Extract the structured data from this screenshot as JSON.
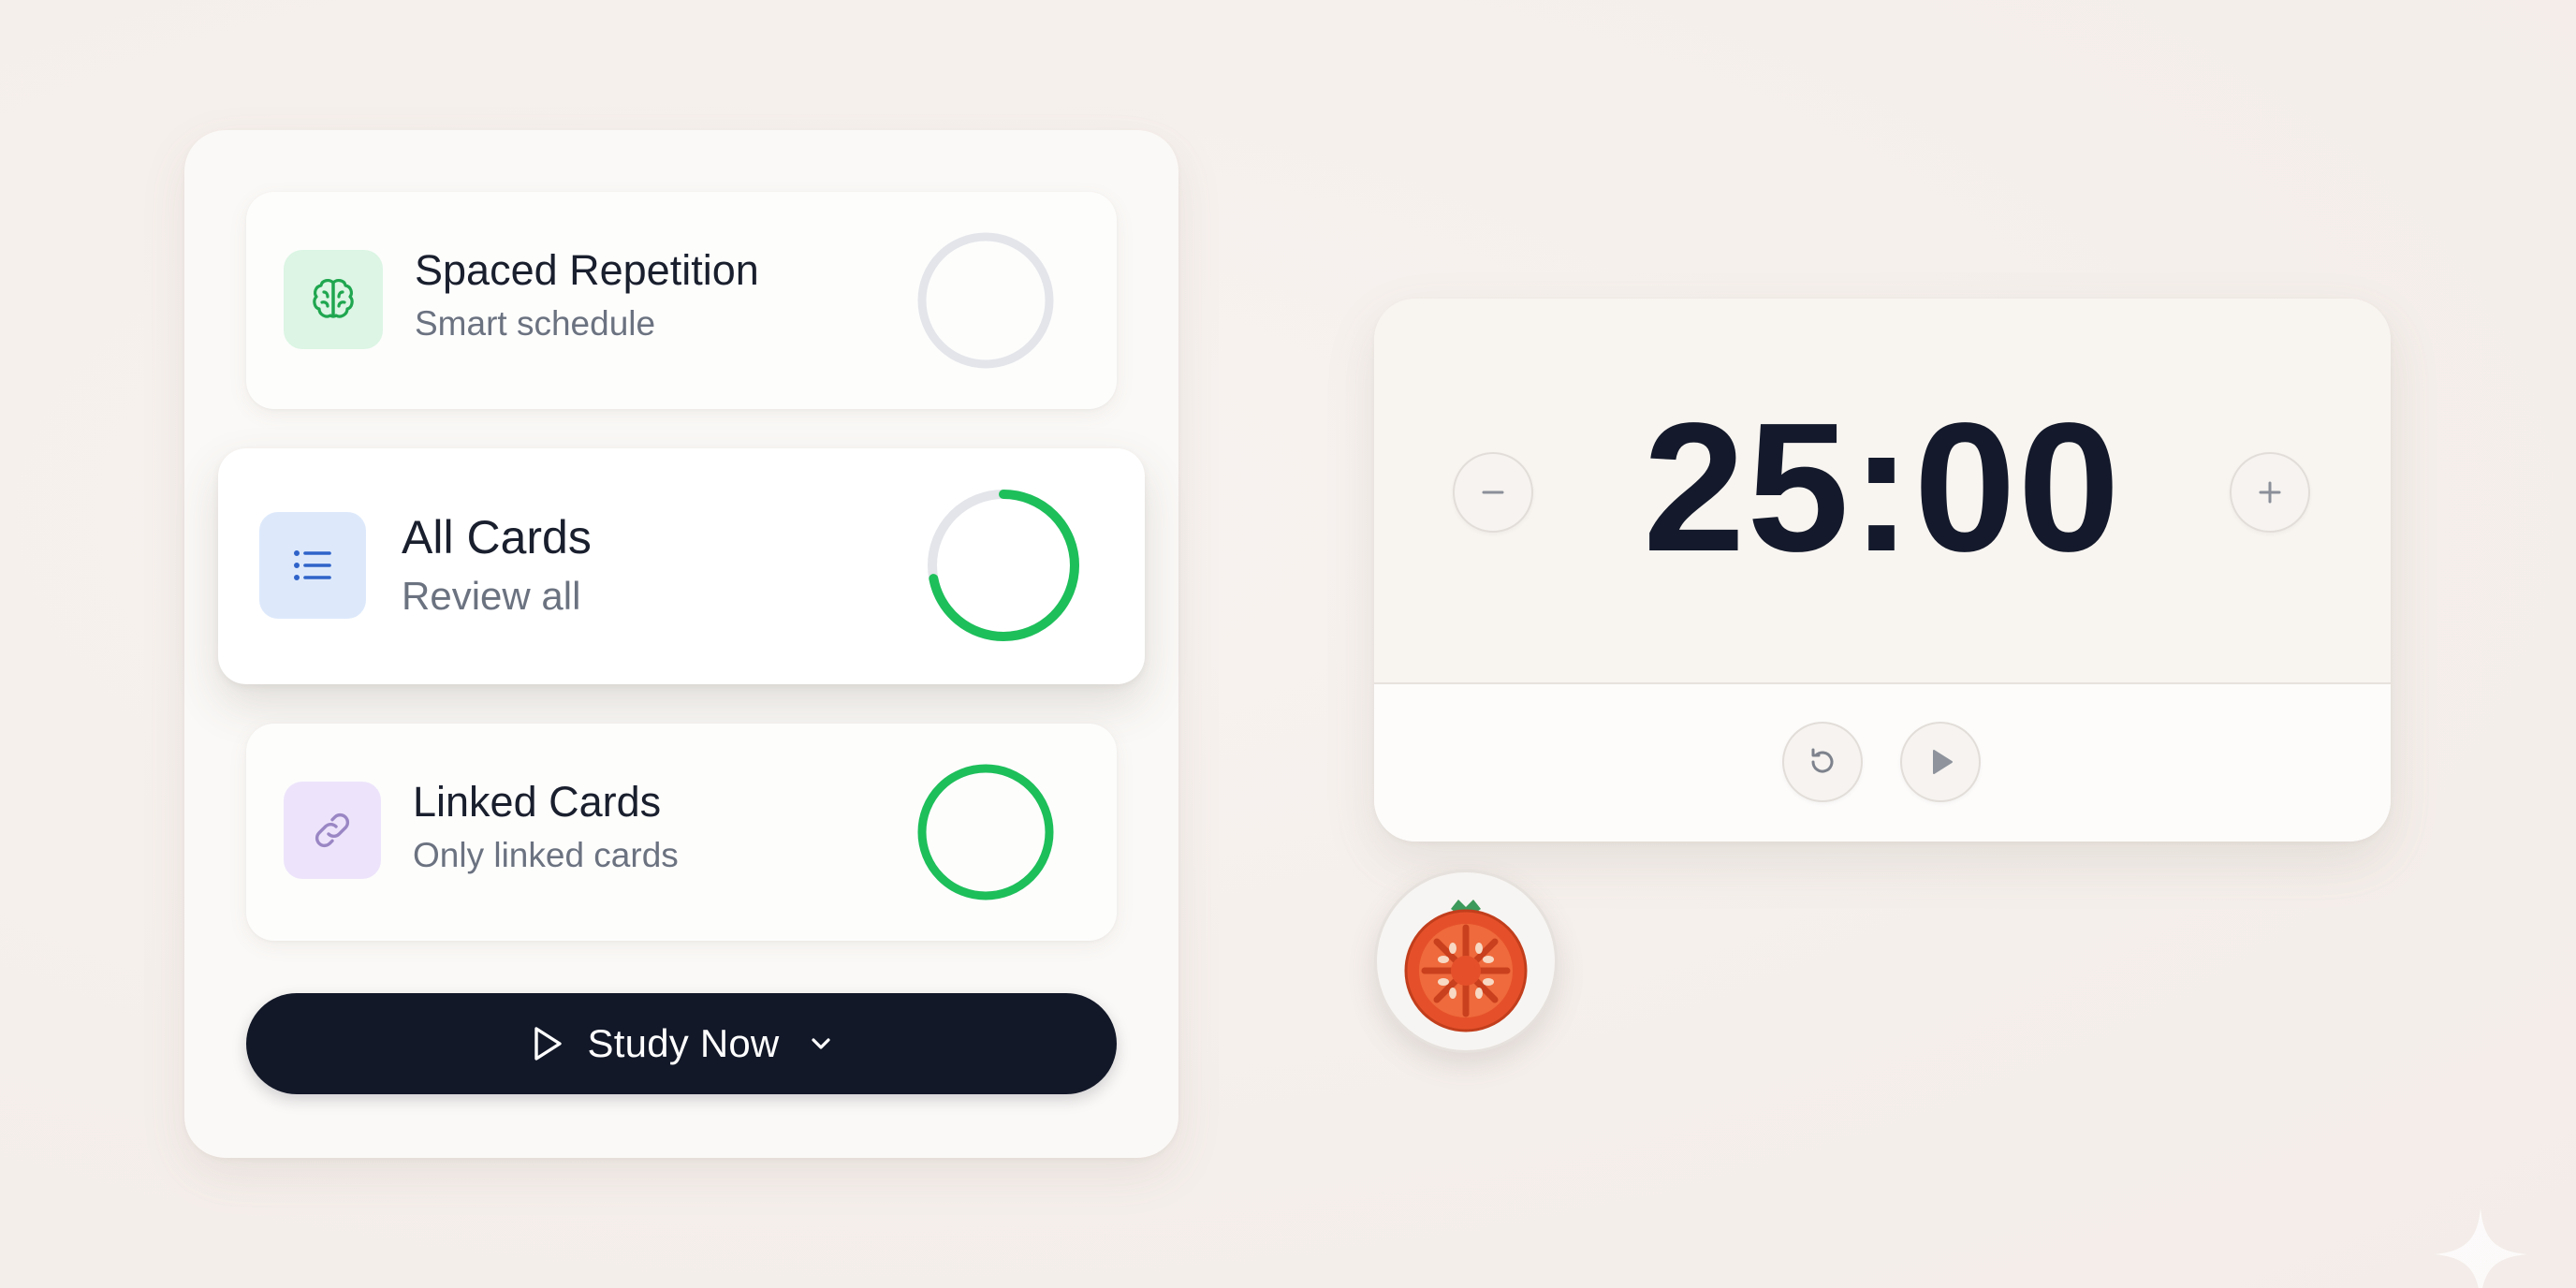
{
  "study_panel": {
    "modes": [
      {
        "title": "Spaced Repetition",
        "subtitle": "Smart schedule",
        "icon": "brain-icon",
        "icon_bg": "#dcf5e4",
        "icon_color": "#1fa64f",
        "progress": 0.0,
        "selected": false
      },
      {
        "title": "All Cards",
        "subtitle": "Review all",
        "icon": "list-icon",
        "icon_bg": "#dde9fb",
        "icon_color": "#2f63c9",
        "progress": 0.72,
        "selected": true
      },
      {
        "title": "Linked Cards",
        "subtitle": "Only linked cards",
        "icon": "link-icon",
        "icon_bg": "#ede4fb",
        "icon_color": "#9a86c4",
        "progress": 1.0,
        "selected": false
      }
    ],
    "study_button": {
      "label": "Study Now",
      "icon": "play-outline-icon",
      "dropdown_icon": "chevron-down-icon"
    }
  },
  "timer": {
    "time": "25:00",
    "decrease_icon": "minus-icon",
    "increase_icon": "plus-icon",
    "reset_icon": "reset-icon",
    "play_icon": "play-icon"
  },
  "tomato": {
    "icon": "tomato-icon"
  },
  "colors": {
    "accent_green": "#1dbf5a",
    "ring_track": "#e3e5ea",
    "dark": "#121828",
    "tomato": "#e8552a"
  }
}
